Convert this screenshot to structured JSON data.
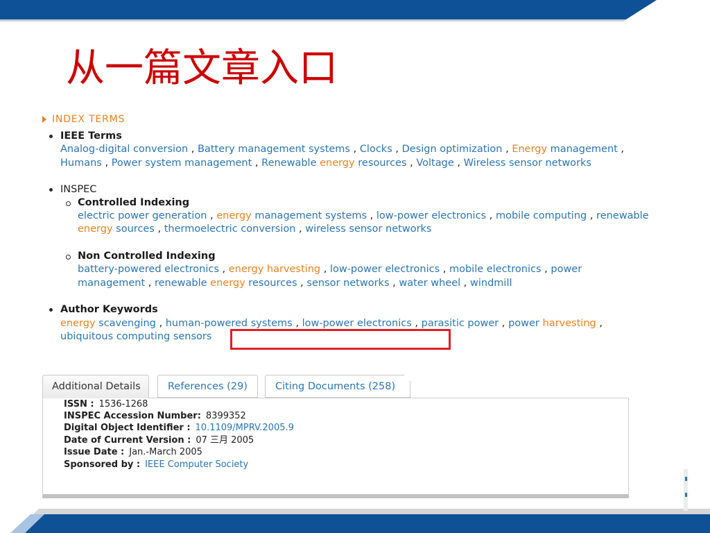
{
  "slide": {
    "title": "从一篇文章入口"
  },
  "colors": {
    "brand_blue": "#0e5196",
    "title_red": "#cc0000",
    "link": "#2a75b3",
    "highlight": "#e8821e",
    "annotation_red": "#e31e24"
  },
  "icons": {
    "section_toggle": "caret-right-icon",
    "bullet": "bullet-icon",
    "sub_bullet": "circle-bullet-icon"
  },
  "index_terms": {
    "heading": "INDEX TERMS",
    "ieee": {
      "label": "IEEE Terms",
      "lines": [
        [
          {
            "text": "Analog-digital conversion",
            "link": true
          },
          {
            "text": " , ",
            "link": false
          },
          {
            "text": "Battery management systems",
            "link": true
          },
          {
            "text": " , ",
            "link": false
          },
          {
            "text": "Clocks",
            "link": true
          },
          {
            "text": " , ",
            "link": false
          },
          {
            "text": "Design optimization",
            "link": true
          },
          {
            "text": " , ",
            "link": false
          },
          {
            "text": "Energy",
            "link": true,
            "highlight": true
          },
          {
            "text": " management",
            "link": true
          },
          {
            "text": " ,",
            "link": false
          }
        ],
        [
          {
            "text": "Humans",
            "link": true
          },
          {
            "text": " , ",
            "link": false
          },
          {
            "text": "Power system management",
            "link": true
          },
          {
            "text": " , ",
            "link": false
          },
          {
            "text": "Renewable ",
            "link": true
          },
          {
            "text": "energy",
            "link": true,
            "highlight": true
          },
          {
            "text": " resources",
            "link": true
          },
          {
            "text": " , ",
            "link": false
          },
          {
            "text": "Voltage",
            "link": true
          },
          {
            "text": " , ",
            "link": false
          },
          {
            "text": "Wireless sensor networks",
            "link": true
          }
        ]
      ]
    },
    "inspec": {
      "label": "INSPEC",
      "controlled": {
        "label": "Controlled Indexing",
        "lines": [
          [
            {
              "text": "electric power generation",
              "link": true
            },
            {
              "text": " , ",
              "link": false
            },
            {
              "text": "energy",
              "link": true,
              "highlight": true
            },
            {
              "text": " management systems",
              "link": true
            },
            {
              "text": " , ",
              "link": false
            },
            {
              "text": "low-power electronics",
              "link": true
            },
            {
              "text": " , ",
              "link": false
            },
            {
              "text": "mobile computing",
              "link": true
            },
            {
              "text": " , ",
              "link": false
            },
            {
              "text": "renewable",
              "link": true
            }
          ],
          [
            {
              "text": "energy",
              "link": true,
              "highlight": true
            },
            {
              "text": " sources",
              "link": true
            },
            {
              "text": " , ",
              "link": false
            },
            {
              "text": "thermoelectric conversion",
              "link": true
            },
            {
              "text": " , ",
              "link": false
            },
            {
              "text": "wireless sensor networks",
              "link": true
            }
          ]
        ]
      },
      "non_controlled": {
        "label": "Non Controlled Indexing",
        "lines": [
          [
            {
              "text": "battery-powered electronics",
              "link": true
            },
            {
              "text": " , ",
              "link": false
            },
            {
              "text": "energy harvesting",
              "link": true,
              "highlight": true
            },
            {
              "text": " , ",
              "link": false
            },
            {
              "text": "low-power electronics",
              "link": true
            },
            {
              "text": " , ",
              "link": false
            },
            {
              "text": "mobile electronics",
              "link": true
            },
            {
              "text": " , ",
              "link": false
            },
            {
              "text": "power",
              "link": true
            }
          ],
          [
            {
              "text": "management",
              "link": true
            },
            {
              "text": " , ",
              "link": false
            },
            {
              "text": "renewable ",
              "link": true
            },
            {
              "text": "energy",
              "link": true,
              "highlight": true
            },
            {
              "text": " resources",
              "link": true
            },
            {
              "text": " , ",
              "link": false
            },
            {
              "text": "sensor networks",
              "link": true
            },
            {
              "text": " , ",
              "link": false
            },
            {
              "text": "water wheel",
              "link": true
            },
            {
              "text": " , ",
              "link": false
            },
            {
              "text": "windmill",
              "link": true
            }
          ]
        ]
      }
    },
    "author_keywords": {
      "label": "Author Keywords",
      "lines": [
        [
          {
            "text": "energy",
            "link": true,
            "highlight": true
          },
          {
            "text": " scavenging",
            "link": true
          },
          {
            "text": " , ",
            "link": false
          },
          {
            "text": "human-powered systems",
            "link": true
          },
          {
            "text": " , ",
            "link": false
          },
          {
            "text": "low-power electronics",
            "link": true
          },
          {
            "text": " , ",
            "link": false
          },
          {
            "text": "parasitic power",
            "link": true
          },
          {
            "text": " , ",
            "link": false
          },
          {
            "text": "power ",
            "link": true
          },
          {
            "text": "harvesting",
            "link": true,
            "highlight": true
          },
          {
            "text": " ,",
            "link": false
          }
        ],
        [
          {
            "text": "ubiquitous computing sensors",
            "link": true
          }
        ]
      ]
    }
  },
  "tabs": [
    {
      "label": "Additional Details",
      "active": true
    },
    {
      "label": "References (29)",
      "active": false
    },
    {
      "label": "Citing Documents (258)",
      "active": false
    }
  ],
  "details": [
    {
      "label": "ISSN :",
      "value": "1536-1268",
      "link": false
    },
    {
      "label": "INSPEC Accession Number:",
      "value": "8399352",
      "link": false
    },
    {
      "label": "Digital Object Identifier :",
      "value": "10.1109/MPRV.2005.9",
      "link": true
    },
    {
      "label": "Date of Current Version :",
      "value": "07 三月 2005",
      "link": false
    },
    {
      "label": "Issue Date :",
      "value": "Jan.-March 2005",
      "link": false
    },
    {
      "label": "Sponsored by :",
      "value": "IEEE Computer Society",
      "link": true
    }
  ]
}
